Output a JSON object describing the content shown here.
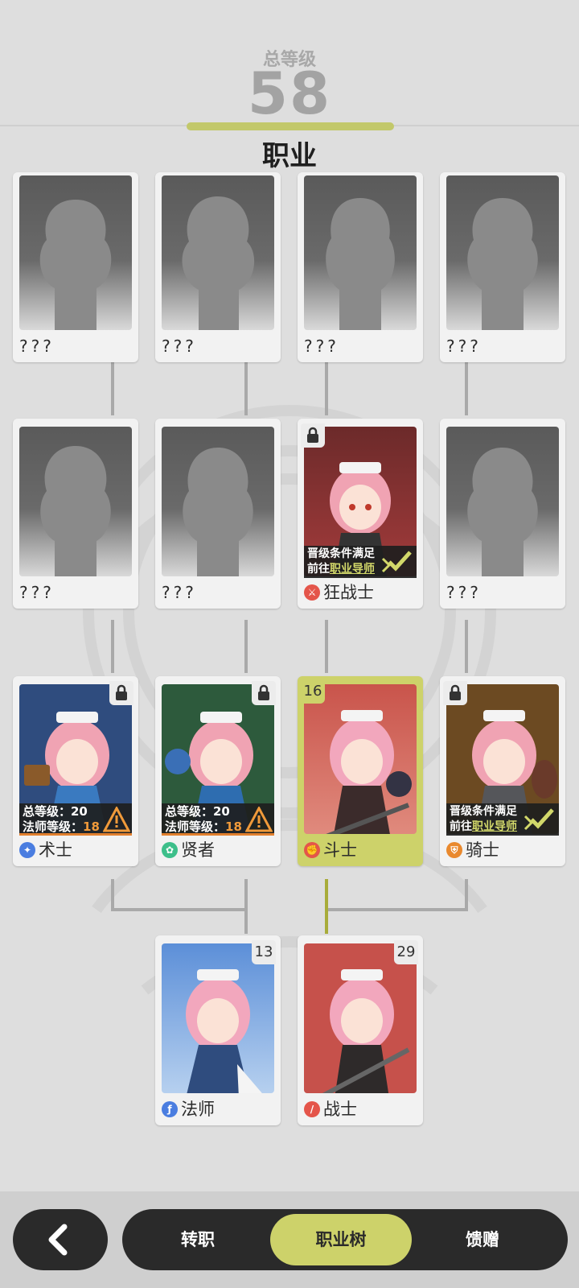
{
  "header": {
    "total_level_label": "总等级",
    "total_level_value": "58",
    "title": "职业"
  },
  "tree": {
    "row1": [
      {
        "name": "???",
        "state": "unknown"
      },
      {
        "name": "???",
        "state": "unknown"
      },
      {
        "name": "???",
        "state": "unknown"
      },
      {
        "name": "???",
        "state": "unknown"
      }
    ],
    "row2": [
      {
        "name": "???",
        "state": "unknown"
      },
      {
        "name": "???",
        "state": "unknown"
      },
      {
        "name": "狂战士",
        "state": "locked",
        "banner_line1": "晋级条件满足",
        "banner_line2_prefix": "前往",
        "banner_link": "职业导师",
        "icon": "berserker-icon",
        "icon_color": "#e4554a"
      },
      {
        "name": "???",
        "state": "unknown"
      }
    ],
    "row3": [
      {
        "name": "术士",
        "state": "locked",
        "req_line1": "总等级：20",
        "req_line2_prefix": "法师等级：",
        "req_line2_value": "18",
        "icon": "warlock-icon",
        "icon_color": "#4a7de0"
      },
      {
        "name": "贤者",
        "state": "locked",
        "req_line1": "总等级：20",
        "req_line2_prefix": "法师等级：",
        "req_line2_value": "18",
        "icon": "sage-icon",
        "icon_color": "#3dbf8a"
      },
      {
        "name": "斗士",
        "state": "active",
        "level": "16",
        "icon": "fighter-icon",
        "icon_color": "#e4554a"
      },
      {
        "name": "骑士",
        "state": "locked",
        "banner_line1": "晋级条件满足",
        "banner_line2_prefix": "前往",
        "banner_link": "职业导师",
        "icon": "knight-icon",
        "icon_color": "#e9892e"
      }
    ],
    "row4": [
      {
        "name": "法师",
        "state": "unlocked",
        "level": "13",
        "icon": "mage-icon",
        "icon_color": "#4a7de0"
      },
      {
        "name": "战士",
        "state": "unlocked",
        "level": "29",
        "icon": "warrior-icon",
        "icon_color": "#e4554a"
      }
    ]
  },
  "nav": {
    "tabs": [
      "转职",
      "职业树",
      "馈赠"
    ],
    "selected_tab": "职业树"
  },
  "colors": {
    "accent": "#cdd26a",
    "warning": "#e2802e",
    "dark": "#2a2a2a"
  }
}
